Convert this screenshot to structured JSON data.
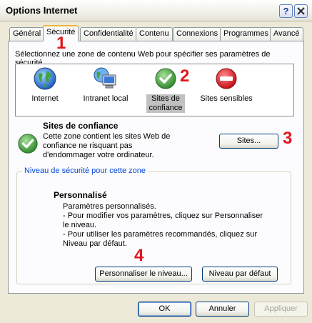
{
  "window": {
    "title": "Options Internet",
    "help_glyph": "?",
    "close_glyph": "✕"
  },
  "tabs": [
    {
      "label": "Général",
      "active": false
    },
    {
      "label": "Sécurité",
      "active": true
    },
    {
      "label": "Confidentialité",
      "active": false
    },
    {
      "label": "Contenu",
      "active": false
    },
    {
      "label": "Connexions",
      "active": false
    },
    {
      "label": "Programmes",
      "active": false
    },
    {
      "label": "Avancé",
      "active": false
    }
  ],
  "security": {
    "intro": "Sélectionnez une zone de contenu Web pour spécifier ses paramètres de sécurité.",
    "zones": [
      {
        "label": "Internet",
        "icon": "globe-icon",
        "selected": false
      },
      {
        "label": "Intranet local",
        "icon": "network-computer-icon",
        "selected": false
      },
      {
        "label": "Sites de confiance",
        "icon": "check-icon",
        "selected": true
      },
      {
        "label": "Sites sensibles",
        "icon": "restricted-icon",
        "selected": false
      }
    ],
    "selected_zone": {
      "title": "Sites de confiance",
      "description": "Cette zone contient les sites Web de confiance ne risquant pas d'endommager votre ordinateur."
    },
    "sites_button": "Sites...",
    "level_group_label": "Niveau de sécurité pour cette zone",
    "level": {
      "title": "Personnalisé",
      "lines": [
        "Paramètres personnalisés.",
        "- Pour modifier vos paramètres, cliquez sur Personnaliser le niveau.",
        "- Pour utiliser les paramètres recommandés, cliquez sur Niveau par défaut."
      ]
    },
    "customize_button": "Personnaliser le niveau...",
    "default_button": "Niveau par défaut"
  },
  "footer": {
    "ok": "OK",
    "cancel": "Annuler",
    "apply": "Appliquer"
  },
  "annotations": [
    "1",
    "2",
    "3",
    "4"
  ],
  "colors": {
    "annotation": "#e1161d",
    "active_tab_accent": "#f1b53b",
    "trusted_green": "#3d9a3a",
    "restricted_red": "#e0141e",
    "group_label_blue": "#0046d5"
  }
}
